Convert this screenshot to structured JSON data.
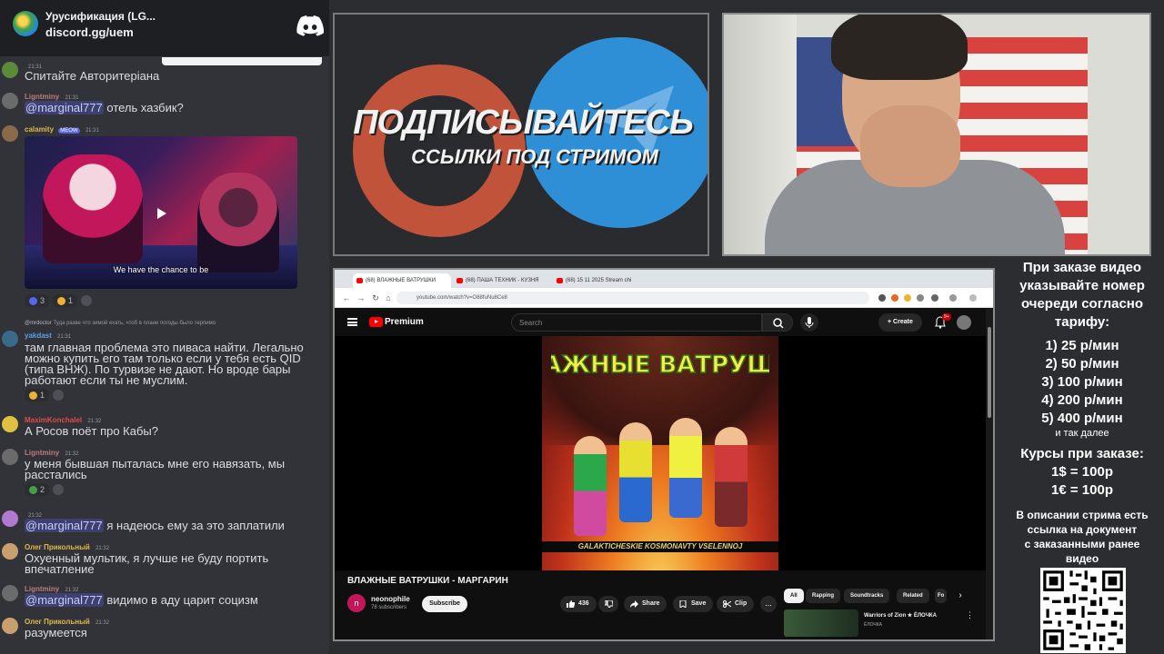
{
  "discord": {
    "server_name": "Урусификация (LG...",
    "invite_link": "discord.gg/uem",
    "logo_icon": "discord-logo-icon"
  },
  "messages": [
    {
      "author": "",
      "time": "21:31",
      "text": "Спитайте Авторитеріана",
      "name_color": "#a0c070"
    },
    {
      "author": "Ligntminy",
      "time": "21:31",
      "mention": "@marginal777",
      "text": "отель хазбик?",
      "name_color": "#c07a7a"
    },
    {
      "author": "calamity",
      "tag": "MEOW",
      "time": "21:31",
      "embed_caption": "We have the chance to be",
      "reactions": [
        {
          "count": "3"
        },
        {
          "count": "1"
        }
      ],
      "name_color": "#e0b84a"
    },
    {
      "reply_to": "@mrdoctor",
      "reply_text": "Туда разве что зимой ехать, чтоб в плане погоды было терпимо",
      "author": "yakdast",
      "time": "21:31",
      "text": "там главная проблема это пиваса найти. Легально можно купить его там только если у тебя есть QID (типа ВНЖ). По турвизе не дают. Но вроде бары работают если ты не муслим.",
      "reactions": [
        {
          "count": "1"
        }
      ],
      "name_color": "#5aa0e8"
    },
    {
      "author": "MaximKonchalel",
      "time": "21:32",
      "text": "А Росов поёт про Кабы?",
      "name_color": "#e04a4a"
    },
    {
      "author": "Ligntminy",
      "time": "21:32",
      "text": "у меня бывшая пыталась мне его навязать, мы расстались",
      "reactions": [
        {
          "count": "2"
        }
      ],
      "name_color": "#c07a7a"
    },
    {
      "author": "",
      "time": "21:32",
      "mention": "@marginal777",
      "text": "я надеюсь ему за это заплатили",
      "name_color": "#b07ad0"
    },
    {
      "author": "Олег Прикольный",
      "time": "21:32",
      "text": "Охуенный мультик, я лучше не буду портить впечатление",
      "name_color": "#e0b84a"
    },
    {
      "author": "Ligntminy",
      "time": "21:32",
      "mention": "@marginal777",
      "text": "видимо в аду царит социзм",
      "name_color": "#c07a7a"
    },
    {
      "author": "Олег Прикольный",
      "time": "21:32",
      "text": "разумеется",
      "name_color": "#e0b84a"
    }
  ],
  "promo": {
    "line1": "ПОДПИСЫВАЙТЕСЬ",
    "line2": "ССЫЛКИ ПОД СТРИМОМ",
    "icons": [
      "patreon-logo-icon",
      "telegram-logo-icon"
    ],
    "colors": {
      "patreon": "#c0533a",
      "telegram": "#2e8fd6"
    }
  },
  "browser": {
    "tabs": [
      "(68) ВЛАЖНЫЕ ВАТРУШКИ",
      "(68) ПАША ТЕХНИК - КУЗНЯ",
      "(68) 15 11 2025 Stream chi"
    ],
    "url": "youtube.com/watch?v=O88fuNu8Ce8"
  },
  "youtube": {
    "brand": "Premium",
    "search_placeholder": "Search",
    "create_label": "Create",
    "notif_badge": "9+",
    "video_title": "ВЛАЖНЫЕ ВАТРУШКИ - МАРГАРИН",
    "channel": "neonophile",
    "channel_initial": "n",
    "subscribers": "78 subscribers",
    "subscribe_label": "Subscribe",
    "likes": "436",
    "share_label": "Share",
    "save_label": "Save",
    "clip_label": "Clip",
    "more_label": "...",
    "chips": [
      "All",
      "Rapping",
      "Soundtracks",
      "Related",
      "Fo"
    ],
    "rec_title": "Warriors of Zion ★ ЁЛОЧКА",
    "rec_channel": "ЁЛОЧКА",
    "cover_title": "ВЛАЖНЫЕ ВАТРУШКИ",
    "cover_strip": "GALAKTICHESKIE KOSMONAVTY VSELENNOJ",
    "accent": "#ff0000"
  },
  "info": {
    "header": [
      "При заказе видео",
      "указывайте номер",
      "очереди согласно",
      "тарифу:"
    ],
    "tariffs": [
      "1) 25 р/мин",
      "2) 50 р/мин",
      "3) 100 р/мин",
      "4) 200 р/мин",
      "5) 400 р/мин"
    ],
    "etc": "и так далее",
    "rates_header": "Курсы при заказе:",
    "rates": [
      "1$ = 100р",
      "1€ = 100р"
    ],
    "desc": [
      "В описании стрима есть",
      "ссылка на документ",
      "с заказанными ранее",
      "видео"
    ],
    "qr_icon": "qr-code-icon"
  }
}
